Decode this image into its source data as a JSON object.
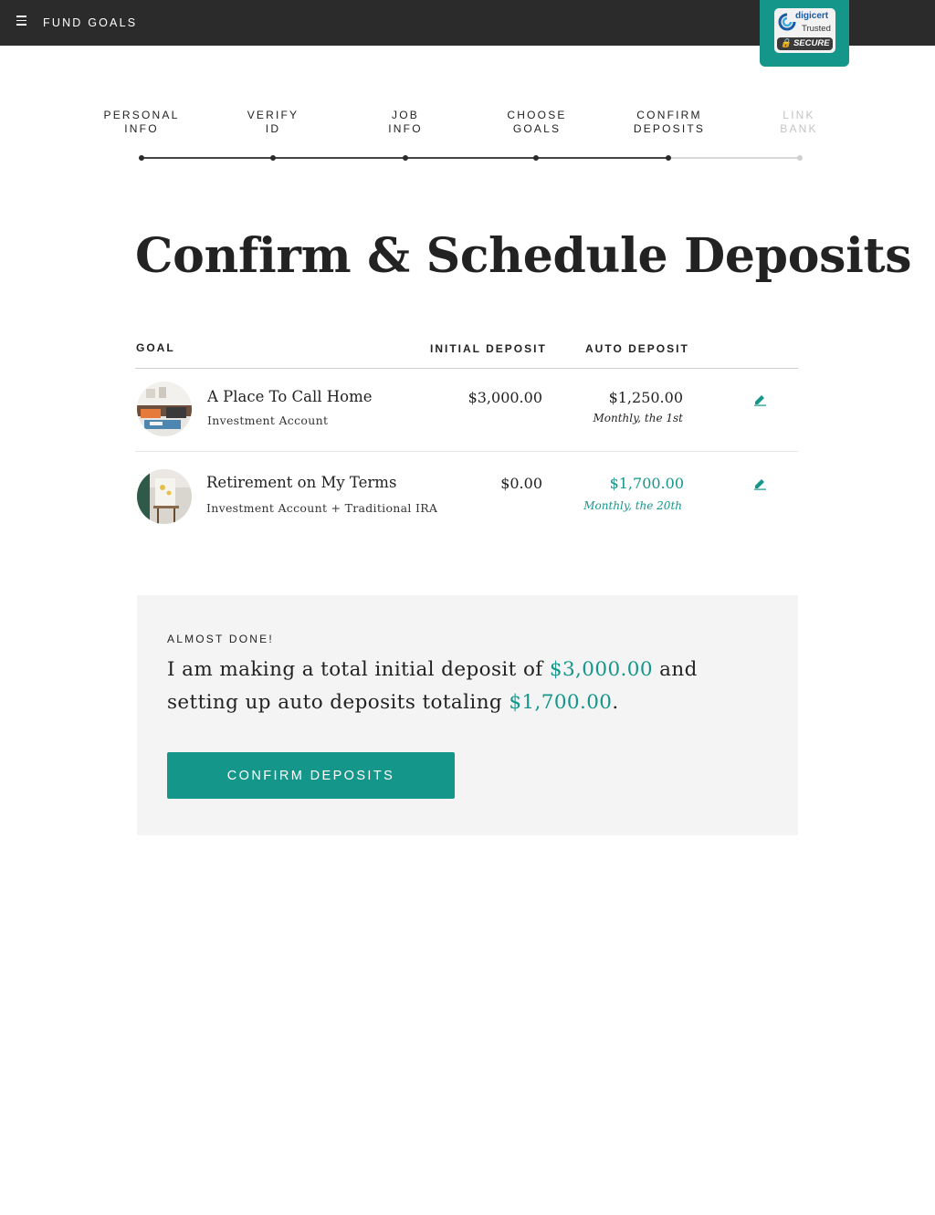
{
  "header": {
    "menu_icon": "hamburger-menu-icon",
    "title": "FUND GOALS",
    "badge": {
      "line1": "digicert",
      "line2": "Trusted",
      "secure": "SECURE"
    }
  },
  "stepper": {
    "steps": [
      {
        "label": "PERSONAL\nINFO",
        "status": "complete"
      },
      {
        "label": "VERIFY\nID",
        "status": "complete"
      },
      {
        "label": "JOB\nINFO",
        "status": "complete"
      },
      {
        "label": "CHOOSE\nGOALS",
        "status": "complete"
      },
      {
        "label": "CONFIRM\nDEPOSITS",
        "status": "current"
      },
      {
        "label": "LINK\nBANK",
        "status": "upcoming"
      }
    ]
  },
  "page_title": "Confirm & Schedule Deposits",
  "table": {
    "headers": {
      "goal": "GOAL",
      "initial": "INITIAL DEPOSIT",
      "auto": "AUTO DEPOSIT"
    },
    "rows": [
      {
        "name": "A Place To Call Home",
        "account": "Investment Account",
        "initial": "$3,000.00",
        "auto": "$1,250.00",
        "frequency": "Monthly, the 1st",
        "highlight": false,
        "edit_icon": "pencil-edit-icon"
      },
      {
        "name": "Retirement on My Terms",
        "account": "Investment Account + Traditional IRA",
        "initial": "$0.00",
        "auto": "$1,700.00",
        "frequency": "Monthly, the 20th",
        "highlight": true,
        "edit_icon": "pencil-edit-icon"
      }
    ]
  },
  "summary": {
    "eyebrow": "ALMOST DONE!",
    "text_1": "I am making a total initial deposit of ",
    "initial_total": "$3,000.00",
    "text_2": " and setting up auto deposits totaling ",
    "auto_total": "$1,700.00",
    "text_3": ".",
    "button_label": "CONFIRM DEPOSITS"
  },
  "colors": {
    "accent": "#14968a",
    "topbar": "#2b2b2b",
    "summary_bg": "#f4f4f4"
  }
}
